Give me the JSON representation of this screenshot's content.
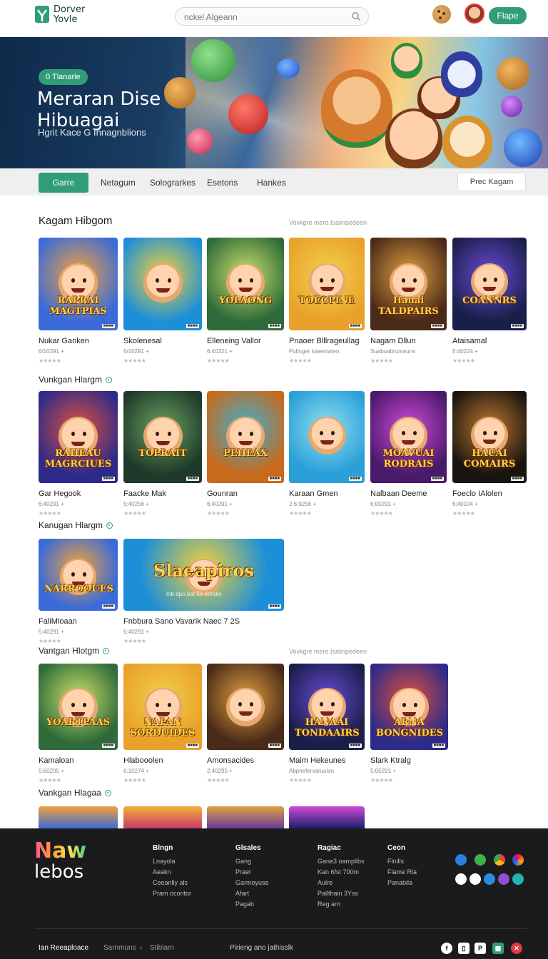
{
  "header": {
    "logo_line1": "Dorver",
    "logo_line2": "Yovle",
    "search_placeholder": "nckel Algeann",
    "cta_label": "Flape"
  },
  "hero": {
    "tag": "0 Tlanarle",
    "title": "Meraran Dise Hibuagai",
    "subtitle": "Hgrit Kace G Innagnblions"
  },
  "nav": {
    "items": [
      "Garre",
      "Netagum",
      "Solograrkes",
      "Esetons",
      "Hankes"
    ],
    "right_button": "Prec Kagam"
  },
  "section": {
    "title": "Kagam Hibgom",
    "hint": "Vovkgre mero.Isalinpedeen",
    "hint2": "Vovkgre mero.Isalinpedeen"
  },
  "rows": [
    {
      "title": "",
      "cards": [
        {
          "name": "Nukar Ganken",
          "meta": "6/10291 +",
          "stars": "★★★★★",
          "banner": "RAPRAI MAGTPIAS"
        },
        {
          "name": "Skolenesal",
          "meta": "6/10291 +",
          "stars": "★★★★★",
          "banner": ""
        },
        {
          "name": "Elleneing Vallor",
          "meta": "6:40321 +",
          "stars": "★★★★★",
          "banner": "YOLAONG"
        },
        {
          "name": "Pnaoer Blllrageullag",
          "meta": "Pullnger iviaematen",
          "stars": "★★★★★",
          "banner": "TOECPINE"
        },
        {
          "name": "Nagam Dllun",
          "meta": "Suabuabrumauns",
          "stars": "★★★★★",
          "banner": "Hauai TALDPAIRS"
        },
        {
          "name": "Ataisamal",
          "meta": "6:40224 +",
          "stars": "★★★★★",
          "banner": "COANNRS"
        }
      ]
    },
    {
      "title": "Vunkgan Hlargm",
      "cards": [
        {
          "name": "Gar Hegook",
          "meta": "6:40291 +",
          "stars": "★★★★★",
          "banner": "RAHEAU MAGRCIUES"
        },
        {
          "name": "Faacke Mak",
          "meta": "6:40256 +",
          "stars": "★★★★★",
          "banner": "TOPRAIT"
        },
        {
          "name": "Gounran",
          "meta": "6:40291 +",
          "stars": "★★★★★",
          "banner": "PEHEAX"
        },
        {
          "name": "Karaan Gmen",
          "meta": "2.6:9256 +",
          "stars": "★★★★★",
          "banner": ""
        },
        {
          "name": "Nalbaan Deeme",
          "meta": "6:00291 +",
          "stars": "★★★★★",
          "banner": "MOAVUAI RODRAIS"
        },
        {
          "name": "Foeclo IAlolen",
          "meta": "6:40104 +",
          "stars": "★★★★★",
          "banner": "HAUAI COMAIRS"
        }
      ]
    },
    {
      "title": "Kanugan Hlargm",
      "cards": [
        {
          "name": "FaliMloaan",
          "meta": "5:40291 +",
          "stars": "★★★★★",
          "banner": "NARROOUES"
        },
        {
          "name": "Fnbbura Sano Vavarik Naec 7 2S",
          "meta": "6:40291 +",
          "stars": "★★★★★",
          "banner": "Slaeapiros",
          "sub": "Irib dpo bat 6o oondie"
        }
      ]
    },
    {
      "title": "Vantgan Hlotgm",
      "cards": [
        {
          "name": "Kamaloan",
          "meta": "5:60295 +",
          "stars": "★★★★★",
          "banner": "YOARTPAAS"
        },
        {
          "name": "Hlabooolen",
          "meta": "6:10274 +",
          "stars": "★★★★★",
          "banner": "NAPAN SORDUIDES"
        },
        {
          "name": "Amonsacides",
          "meta": "2:40295 +",
          "stars": "★★★★★",
          "banner": ""
        },
        {
          "name": "Maim Hekeunes",
          "meta": "Abpnefervaruulon",
          "stars": "★★★★★",
          "banner": "HANAAI TONDAAIRS"
        },
        {
          "name": "Slark Ktralg",
          "meta": "5:00291 +",
          "stars": "★★★★★",
          "banner": "ARNA BONGNIDES"
        }
      ]
    },
    {
      "title": "Vankgan Hlagaa",
      "cards": []
    }
  ],
  "footer": {
    "logo_line1": "Naw",
    "logo_line2": "lebos",
    "columns": [
      {
        "title": "Blngn",
        "links": [
          "Lnayola",
          "Aeakn",
          "Ceeanlly als",
          "Pram ocoritor"
        ]
      },
      {
        "title": "Glsales",
        "links": [
          "Gang",
          "Prael",
          "Garmoyuse",
          "Afart",
          "Pagab"
        ]
      },
      {
        "title": "Ragiac",
        "links": [
          "Gane3 oamplibs",
          "Kan 6fst 700m",
          "Aulre",
          "Pallthain 3Yss",
          "Reg arn"
        ]
      },
      {
        "title": "Ceon",
        "links": [
          "Flnills",
          "Flame Rla",
          "Panabila"
        ]
      }
    ],
    "bottom_left": "Ian Reeaploace",
    "bottom_crumb1": "Sarnmuns",
    "bottom_crumb2": "Stiblarn",
    "bottom_mid": "Pirieng ano jathisslk"
  }
}
